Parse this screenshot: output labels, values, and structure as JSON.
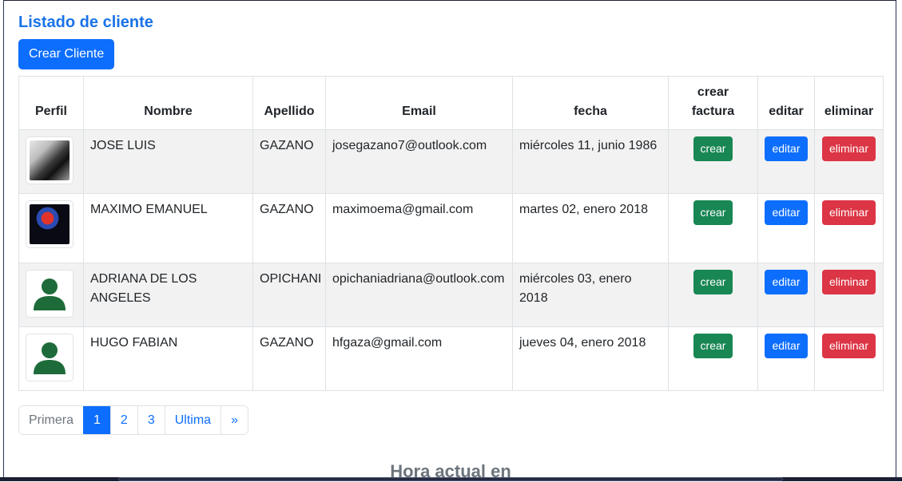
{
  "page": {
    "title": "Listado de cliente",
    "create_button": "Crear Cliente",
    "footer_heading": "Hora actual en"
  },
  "table": {
    "headers": [
      "Perfil",
      "Nombre",
      "Apellido",
      "Email",
      "fecha",
      "crear factura",
      "editar",
      "eliminar"
    ],
    "rows": [
      {
        "avatar": "photo",
        "nombre": "JOSE LUIS",
        "apellido": "GAZANO",
        "email": "josegazano7@outlook.com",
        "fecha": "miércoles 11, junio 1986",
        "crear": "crear",
        "editar": "editar",
        "eliminar": "eliminar"
      },
      {
        "avatar": "photo",
        "nombre": "MAXIMO EMANUEL",
        "apellido": "GAZANO",
        "email": "maximoema@gmail.com",
        "fecha": "martes 02, enero 2018",
        "crear": "crear",
        "editar": "editar",
        "eliminar": "eliminar"
      },
      {
        "avatar": "user-icon",
        "nombre": "ADRIANA DE LOS ANGELES",
        "apellido": "OPICHANI",
        "email": "opichaniadriana@outlook.com",
        "fecha": "miércoles 03, enero 2018",
        "crear": "crear",
        "editar": "editar",
        "eliminar": "eliminar"
      },
      {
        "avatar": "user-icon",
        "nombre": "HUGO FABIAN",
        "apellido": "GAZANO",
        "email": "hfgaza@gmail.com",
        "fecha": "jueves 04, enero 2018",
        "crear": "crear",
        "editar": "editar",
        "eliminar": "eliminar"
      }
    ]
  },
  "pagination": {
    "first": "Primera",
    "pages": [
      "1",
      "2",
      "3"
    ],
    "active": "1",
    "last": "Ultima",
    "next": "»"
  },
  "colors": {
    "title": "#1a73e8",
    "primary": "#0d6efd",
    "success": "#198754",
    "danger": "#dc3545",
    "user_icon": "#1e6b3a"
  }
}
